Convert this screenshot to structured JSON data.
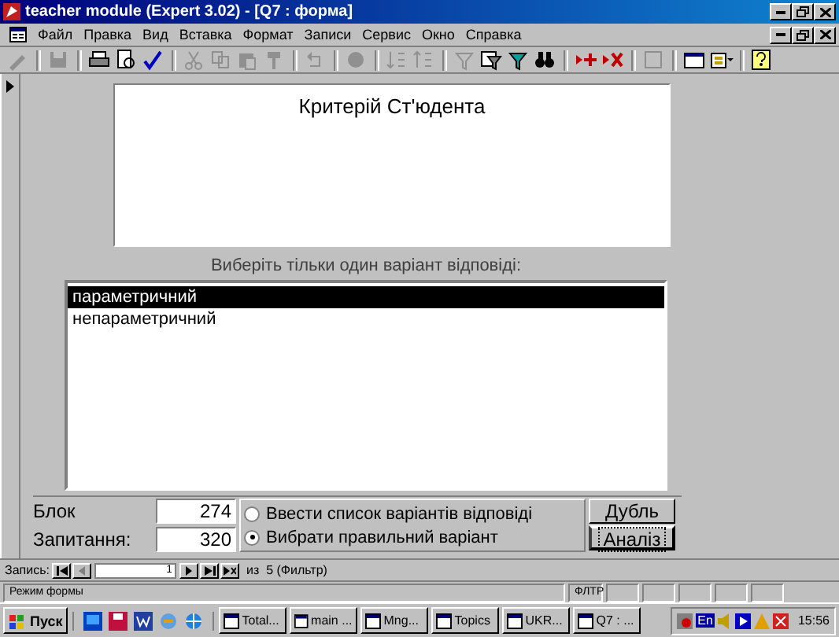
{
  "window": {
    "title": "teacher module (Expert 3.02) - [Q7 : форма]"
  },
  "menu": [
    "Файл",
    "Правка",
    "Вид",
    "Вставка",
    "Формат",
    "Записи",
    "Сервис",
    "Окно",
    "Справка"
  ],
  "form": {
    "question": "Критерій Ст'юдента",
    "prompt": "Виберіть тільки один варіант відповіді:",
    "answers": [
      {
        "text": "параметричний",
        "selected": true
      },
      {
        "text": "непараметричний",
        "selected": false
      }
    ],
    "fields": [
      {
        "label": "Блок",
        "value": "274"
      },
      {
        "label": "Запитання:",
        "value": "320"
      }
    ],
    "mode_options": [
      {
        "label": "Ввести список варіантів відповіді",
        "selected": false
      },
      {
        "label": "Вибрати правильний варіант",
        "selected": true
      }
    ],
    "buttons": [
      {
        "label": "Дубль",
        "focused": false
      },
      {
        "label": "Аналіз",
        "focused": true
      }
    ]
  },
  "record_nav": {
    "label": "Запись:",
    "current": "1",
    "total": "из  5 (Фильтр)"
  },
  "status_bar": {
    "mode": "Режим формы",
    "indicator": "ФЛТР"
  },
  "taskbar": {
    "start": "Пуск",
    "tasks": [
      "Total...",
      "main ...",
      "Mng...",
      "Topics",
      "UKR...",
      "Q7 : ..."
    ],
    "language": "En",
    "clock": "15:56"
  }
}
